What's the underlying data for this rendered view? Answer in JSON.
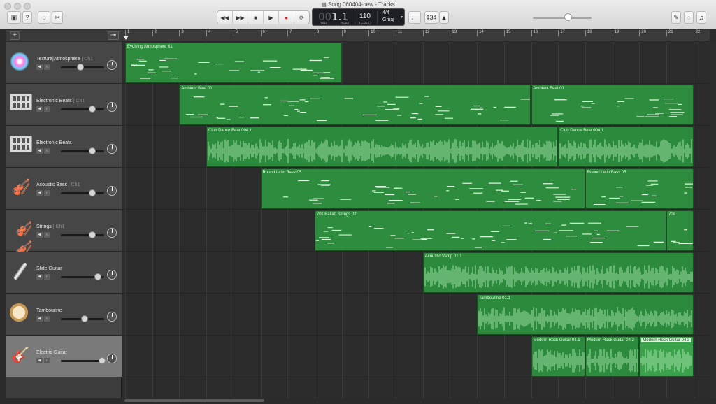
{
  "window": {
    "title": "Song 060404-new - Tracks"
  },
  "toolbar": {
    "library_icon": "library-icon",
    "help_label": "?",
    "smart_controls_icon": "smart-controls-icon",
    "editors_icon": "scissors-icon",
    "rewind": "◀◀",
    "forward": "▶▶",
    "stop": "■",
    "play": "▶",
    "record": "●",
    "cycle": "⟳",
    "tuner_icon": "tuner-icon",
    "count_in": "¢34",
    "metronome_icon": "metronome-icon",
    "notepad_icon": "notepad-icon",
    "loops_icon": "loops-icon",
    "media_icon": "media-icon"
  },
  "lcd": {
    "position_dim": "00",
    "position": "1.1",
    "bar_label": "BAR",
    "beat_label": "BEAT",
    "tempo": "110",
    "tempo_label": "TEMPO",
    "time_signature": "4/4",
    "key": "Gmaj"
  },
  "master_volume": 0.6,
  "header": {
    "add_label": "+",
    "catch_label": "⇥"
  },
  "ruler": {
    "bars": [
      "1",
      "2",
      "3",
      "4",
      "5",
      "6",
      "7",
      "8",
      "9",
      "10",
      "11",
      "12",
      "13",
      "14",
      "15",
      "16",
      "17",
      "18",
      "19",
      "20",
      "21",
      "22"
    ]
  },
  "tracks": [
    {
      "name": "Texture|Atmosphere",
      "ch": "| Ch1",
      "icon": "synth-sparkle-icon",
      "volume": 0.45
    },
    {
      "name": "Electronic Beats",
      "ch": "| Ch1",
      "icon": "drum-machine-icon",
      "volume": 0.72
    },
    {
      "name": "Electronic Beats",
      "ch": "",
      "icon": "drum-machine-icon",
      "volume": 0.72
    },
    {
      "name": "Acoustic Bass",
      "ch": "| Ch1",
      "icon": "double-bass-icon",
      "volume": 0.72
    },
    {
      "name": "Strings",
      "ch": "| Ch1",
      "icon": "strings-icon",
      "volume": 0.72
    },
    {
      "name": "Slide Guitar",
      "ch": "",
      "icon": "slide-bar-icon",
      "volume": 0.85
    },
    {
      "name": "Tambourine",
      "ch": "",
      "icon": "tambourine-icon",
      "volume": 0.55
    },
    {
      "name": "Electric Guitar",
      "ch": "",
      "icon": "electric-guitar-icon",
      "volume": 0.95
    }
  ],
  "regions": [
    {
      "track": 0,
      "label": "Evolving Atmosphere 01",
      "start": 1,
      "end": 9,
      "kind": "midi"
    },
    {
      "track": 1,
      "label": "Ambient Beat 01",
      "start": 3,
      "end": 16,
      "kind": "midi"
    },
    {
      "track": 1,
      "label": "Ambient Beat 01",
      "start": 16,
      "end": 22,
      "kind": "midi"
    },
    {
      "track": 2,
      "label": "Club Dance Beat 004.1",
      "start": 4,
      "end": 17,
      "kind": "audio"
    },
    {
      "track": 2,
      "label": "Club Dance Beat 004.1",
      "start": 17,
      "end": 22,
      "kind": "audio"
    },
    {
      "track": 3,
      "label": "Round Latin Bass 05",
      "start": 6,
      "end": 18,
      "kind": "midi"
    },
    {
      "track": 3,
      "label": "Round Latin Bass 05",
      "start": 18,
      "end": 22,
      "kind": "midi"
    },
    {
      "track": 4,
      "label": "70s Ballad Strings 02",
      "start": 8,
      "end": 21,
      "kind": "midi"
    },
    {
      "track": 4,
      "label": "70s",
      "start": 21,
      "end": 22,
      "kind": "midi"
    },
    {
      "track": 5,
      "label": "Acoustic Vamp 01.1",
      "start": 12,
      "end": 22,
      "kind": "audio"
    },
    {
      "track": 6,
      "label": "Tambourine 01.1",
      "start": 14,
      "end": 22,
      "kind": "audio"
    },
    {
      "track": 7,
      "label": "Modern Rock Guitar 04.1",
      "start": 16,
      "end": 18,
      "kind": "audio"
    },
    {
      "track": 7,
      "label": "Modern Rock Guitar 04.2",
      "start": 18,
      "end": 20,
      "kind": "audio"
    },
    {
      "track": 7,
      "label": "Modern Rock Guitar 04.3",
      "start": 20,
      "end": 22,
      "kind": "audio",
      "selected": true
    }
  ]
}
